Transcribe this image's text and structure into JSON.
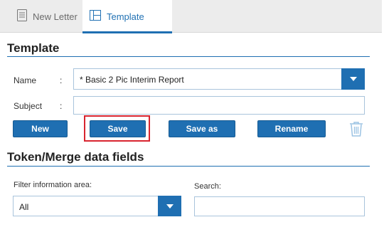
{
  "tabs": [
    {
      "label": "New Letter",
      "icon": "document-icon",
      "active": false
    },
    {
      "label": "Template",
      "icon": "layout-icon",
      "active": true
    }
  ],
  "template_section": {
    "title": "Template",
    "name_label": "Name",
    "name_colon": ":",
    "name_value": "* Basic 2 Pic Interim Report",
    "subject_label": "Subject",
    "subject_colon": ":",
    "subject_value": ""
  },
  "buttons": {
    "new": "New",
    "save": "Save",
    "save_as": "Save as",
    "rename": "Rename"
  },
  "token_section": {
    "title": "Token/Merge data fields",
    "filter_label": "Filter information area:",
    "filter_value": "All",
    "search_label": "Search:",
    "search_value": ""
  },
  "colors": {
    "accent": "#1f6fb2",
    "highlight": "#d8242f"
  }
}
